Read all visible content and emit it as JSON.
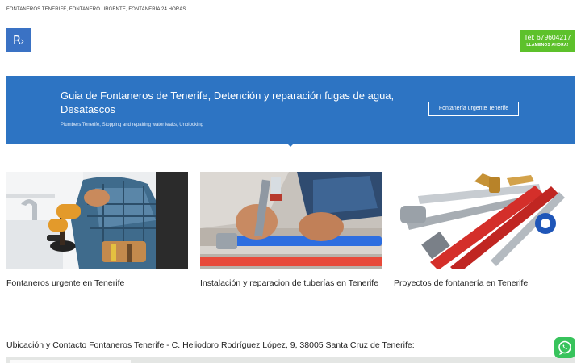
{
  "topbar": {
    "text": "FONTANEROS TENERIFE, FONTANERO URGENTE, FONTANERÍA 24 HORAS"
  },
  "logo": {
    "letter": "R",
    "chevron": "›",
    "color": "#3a72c4"
  },
  "call": {
    "tel": "Tel: 679604217",
    "sub": "LLAMENOS AHORA!",
    "color": "#5dc12b"
  },
  "hero": {
    "title": "Guia de Fontaneros de Tenerife, Detención y reparación fugas de agua, Desatascos",
    "subtitle": "Plumbers Tenerife, Stopping and repairing water leaks, Unblocking",
    "cta": "Fontanería urgente Tenerife",
    "bg": "#2d74c3"
  },
  "cards": [
    {
      "title": "Fontaneros urgente en Tenerife"
    },
    {
      "title": "Instalación y reparacion de tuberías en Tenerife"
    },
    {
      "title": "Proyectos de fontanería en Tenerife"
    }
  ],
  "location": {
    "text": "Ubicación y Contacto Fontaneros Tenerife - C. Heliodoro Rodríguez López, 9, 38005 Santa Cruz de Tenerife:"
  },
  "whatsapp": {
    "icon": "whatsapp-icon",
    "color": "#38c35c"
  }
}
